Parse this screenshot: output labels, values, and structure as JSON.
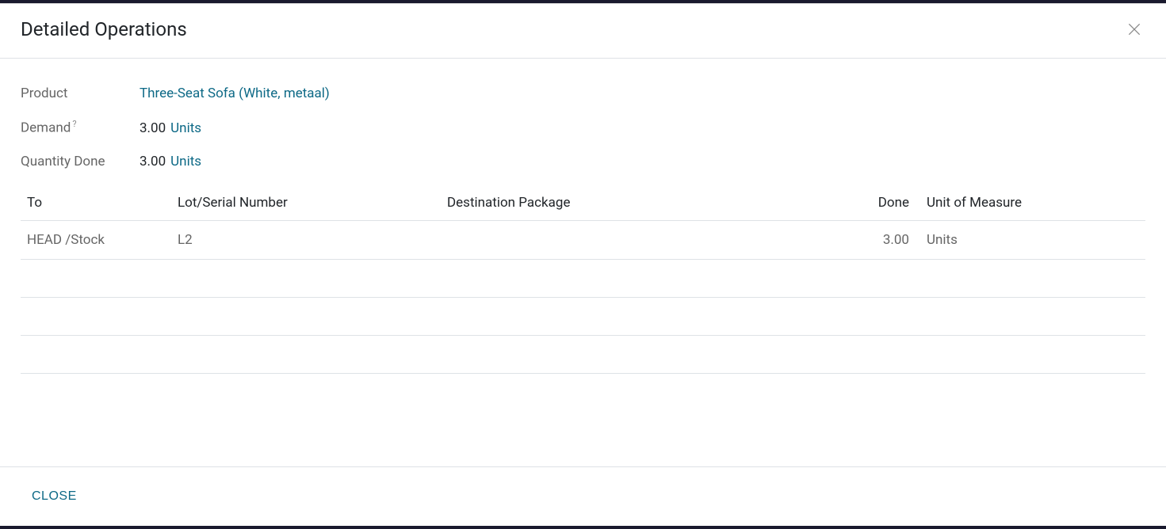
{
  "modal": {
    "title": "Detailed Operations",
    "fields": {
      "product_label": "Product",
      "product_value": "Three-Seat Sofa (White, metaal)",
      "demand_label": "Demand",
      "demand_help": "?",
      "demand_value": "3.00",
      "demand_unit": "Units",
      "qty_done_label": "Quantity Done",
      "qty_done_value": "3.00",
      "qty_done_unit": "Units"
    },
    "table": {
      "headers": {
        "to": "To",
        "lot": "Lot/Serial Number",
        "dest": "Destination Package",
        "done": "Done",
        "uom": "Unit of Measure"
      },
      "rows": [
        {
          "to": "HEAD /Stock",
          "lot": "L2",
          "dest": "",
          "done": "3.00",
          "uom": "Units"
        }
      ]
    },
    "footer": {
      "close_label": "CLOSE"
    }
  }
}
